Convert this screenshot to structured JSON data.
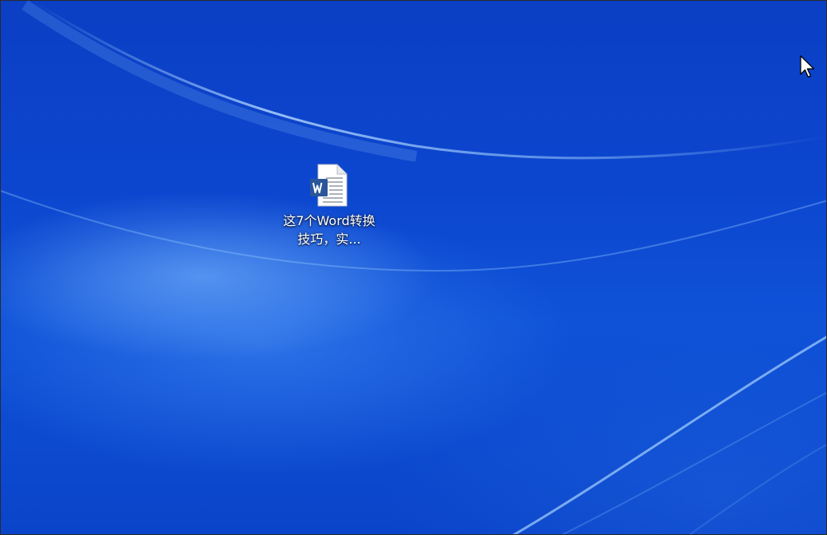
{
  "desktop": {
    "wallpaper": {
      "base_color": "#0b45cc",
      "highlight_color": "#8fc4ff"
    },
    "icons": [
      {
        "type": "word-document",
        "icon": "word-document-icon",
        "label": "这7个Word转换技巧，实..."
      }
    ],
    "cursor": "arrow-cursor"
  }
}
